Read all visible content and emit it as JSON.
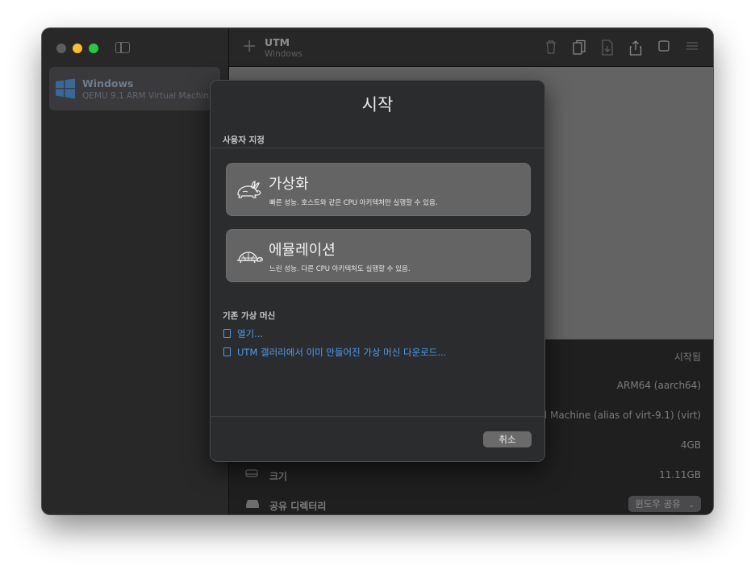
{
  "sidebar": {
    "vm": {
      "name": "Windows",
      "subtitle": "QEMU 9.1 ARM Virtual Machin..."
    }
  },
  "toolbar": {
    "title": "UTM",
    "subtitle": "Windows",
    "icons": [
      "trash-icon",
      "clone-icon",
      "export-icon",
      "share-icon",
      "stop-icon",
      "settings-icon"
    ]
  },
  "details": {
    "status": "시작됨",
    "architecture": "ARM64 (aarch64)",
    "machine": "ual Machine (alias of virt-9.1) (virt)",
    "memory": "4GB",
    "size_label": "크기",
    "size": "11.11GB",
    "shared_dir_label": "공유 디렉터리",
    "shared_dir_value": "윈도우 공유"
  },
  "sheet": {
    "title": "시작",
    "custom_section": "사용자 지정",
    "virtualize": {
      "title": "가상화",
      "desc": "빠른 성능. 호스트와 같은 CPU 아키텍처만 실행할 수 있음."
    },
    "emulate": {
      "title": "에뮬레이션",
      "desc": "느린 성능. 다른 CPU 아키텍처도 실행할 수 있음."
    },
    "existing_section": "기존 가상 머신",
    "open_link": "열기...",
    "gallery_link": "UTM 갤러리에서 이미 만들어진 가상 머신 다운로드...",
    "cancel": "취소"
  },
  "colors": {
    "accent": "#4a9ff5",
    "window_bg": "#1e1e1f",
    "sheet_bg": "#2b2c2d",
    "choice_bg": "#646464"
  }
}
